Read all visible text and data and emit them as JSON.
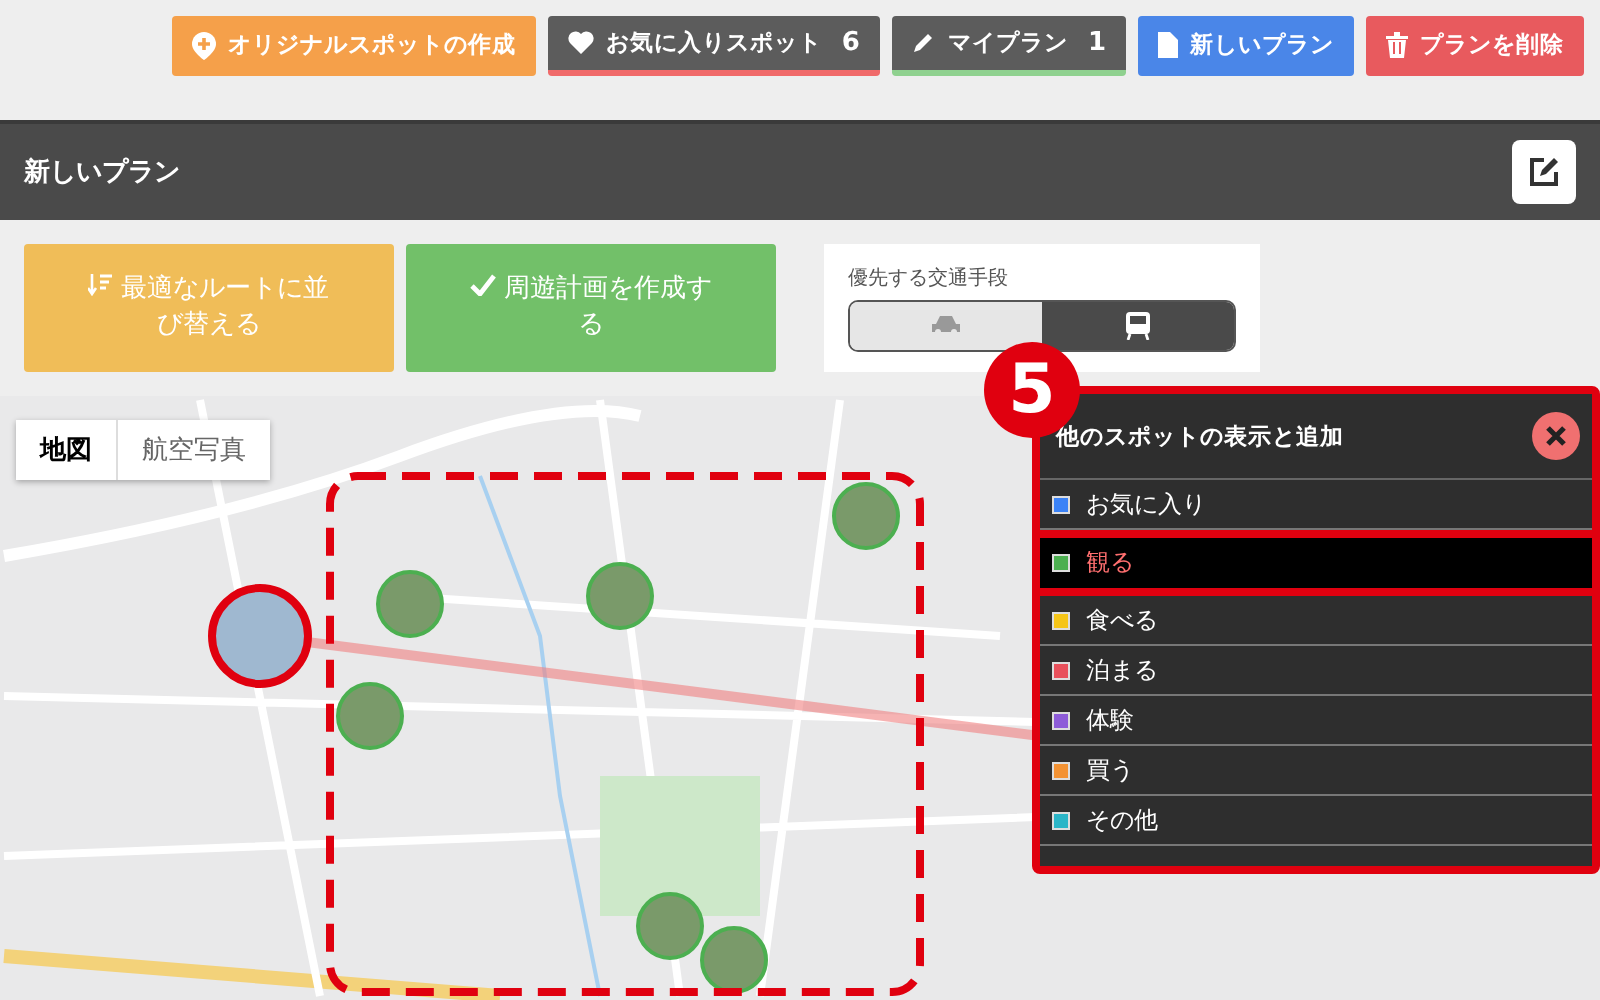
{
  "top_buttons": [
    {
      "kind": "create",
      "label": "オリジナルスポットの作成"
    },
    {
      "kind": "favorites",
      "label": "お気に入りスポット",
      "count": "6"
    },
    {
      "kind": "myplan",
      "label": "マイプラン",
      "count": "1"
    },
    {
      "kind": "new",
      "label": "新しいプラン"
    },
    {
      "kind": "delete",
      "label": "プランを削除"
    }
  ],
  "header": {
    "title": "新しいプラン"
  },
  "actions": [
    {
      "kind": "sort",
      "label": "最適なルートに並び替える"
    },
    {
      "kind": "check",
      "label": "周遊計画を作成する"
    }
  ],
  "transport": {
    "label": "優先する交通手段",
    "options": [
      {
        "kind": "car",
        "selected": false
      },
      {
        "kind": "train",
        "selected": true
      }
    ]
  },
  "map": {
    "type_tabs": [
      {
        "label": "地図",
        "selected": true
      },
      {
        "label": "航空写真",
        "selected": false
      }
    ],
    "annotation_number": "5"
  },
  "panel": {
    "title": "他のスポットの表示と追加",
    "categories": [
      {
        "label": "お気に入り",
        "color": "#3b82f6",
        "selected": false
      },
      {
        "label": "観る",
        "color": "#4caf50",
        "selected": true
      },
      {
        "label": "食べる",
        "color": "#f5c518",
        "selected": false
      },
      {
        "label": "泊まる",
        "color": "#e8505b",
        "selected": false
      },
      {
        "label": "体験",
        "color": "#8e5cd9",
        "selected": false
      },
      {
        "label": "買う",
        "color": "#f39233",
        "selected": false
      },
      {
        "label": "その他",
        "color": "#2bb5c7",
        "selected": false
      }
    ]
  }
}
